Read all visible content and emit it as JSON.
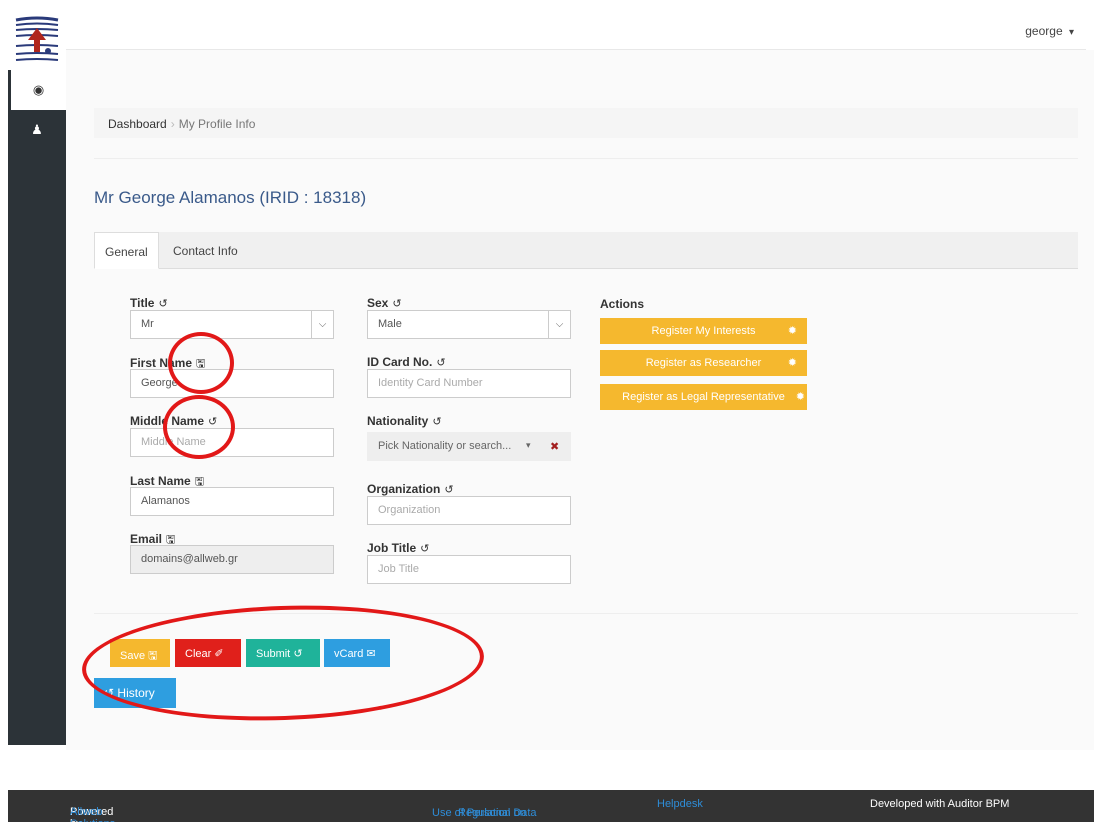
{
  "header": {
    "user": "george",
    "caret": "▾"
  },
  "sidebar": {
    "items": [
      {
        "icon": "dashboard-icon",
        "glyph": "◉"
      },
      {
        "icon": "user-icon",
        "glyph": "♟"
      }
    ]
  },
  "breadcrumb": {
    "root": "Dashboard",
    "sep": "›",
    "current": "My Profile Info"
  },
  "page": {
    "title": "Mr George Alamanos (IRID : 18318)"
  },
  "tabs": [
    {
      "label": "General"
    },
    {
      "label": "Contact Info"
    }
  ],
  "icons": {
    "history": "↺",
    "save": "🖫",
    "chevron": "⌵",
    "close": "✖",
    "gear": "✹",
    "eraser": "✐",
    "envelope": "✉"
  },
  "form": {
    "title_label": "Title",
    "title_value": "Mr",
    "first_name_label": "First Name",
    "first_name_value": "George",
    "middle_name_label": "Middle Name",
    "middle_name_placeholder": "Middle Name",
    "last_name_label": "Last Name",
    "last_name_value": "Alamanos",
    "email_label": "Email",
    "email_value": "domains@allweb.gr",
    "sex_label": "Sex",
    "sex_value": "Male",
    "id_card_label": "ID Card No.",
    "id_card_placeholder": "Identity Card Number",
    "nationality_label": "Nationality",
    "nationality_placeholder": "Pick Nationality or search...",
    "organization_label": "Organization",
    "organization_placeholder": "Organization",
    "job_title_label": "Job Title",
    "job_title_placeholder": "Job Title"
  },
  "actions": {
    "heading": "Actions",
    "items": [
      {
        "label": "Register My Interests"
      },
      {
        "label": "Register as Researcher"
      },
      {
        "label": "Register as Legal Representative"
      }
    ]
  },
  "buttons": {
    "save": "Save",
    "clear": "Clear",
    "submit": "Submit",
    "vcard": "vCard",
    "history": "History"
  },
  "footer": {
    "powered_by": "Powered by",
    "company": "Allweb Solutions S.A.",
    "regulation_line1": "Regulation on Collection, Processing and",
    "regulation_line2": "Use of Personal Data",
    "helpdesk": "Helpdesk",
    "developed": "Developed with Auditor BPM"
  },
  "colors": {
    "sidebar": "#2c3338",
    "action": "#f5b82e",
    "save": "#f5b82e",
    "clear": "#e0201b",
    "submit": "#1fb39a",
    "vcard": "#2e9ee0",
    "history": "#2e9ee0",
    "annotation": "#e21818"
  }
}
